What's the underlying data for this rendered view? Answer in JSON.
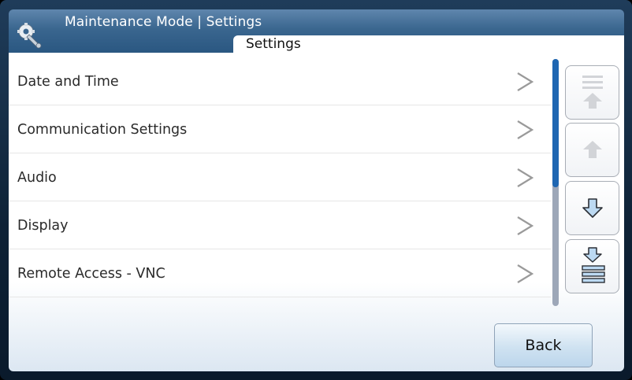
{
  "header": {
    "title": "Maintenance Mode | Settings",
    "icon": "gear-wrench-icon"
  },
  "tab": {
    "label": "Settings"
  },
  "items": [
    {
      "label": "Date and Time"
    },
    {
      "label": "Communication Settings"
    },
    {
      "label": "Audio"
    },
    {
      "label": "Display"
    },
    {
      "label": "Remote Access - VNC"
    }
  ],
  "scroll_buttons": [
    {
      "icon": "scroll-to-top-icon",
      "enabled": false
    },
    {
      "icon": "scroll-up-icon",
      "enabled": false
    },
    {
      "icon": "scroll-down-icon",
      "enabled": true
    },
    {
      "icon": "scroll-to-bottom-icon",
      "enabled": true
    }
  ],
  "back_button": {
    "label": "Back"
  },
  "colors": {
    "header": "#3a668f",
    "scroll_thumb": "#1e66b2",
    "accent_light": "#cfe2f1"
  }
}
